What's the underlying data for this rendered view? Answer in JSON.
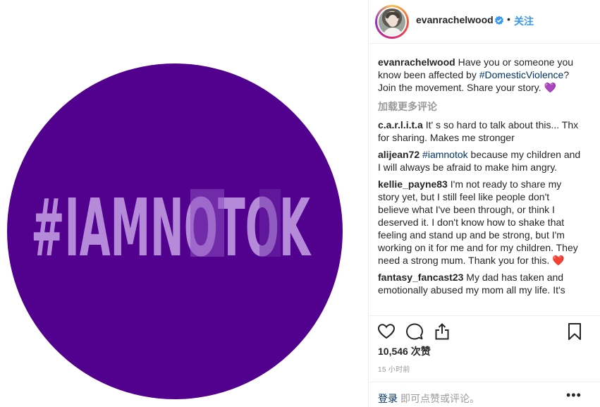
{
  "post": {
    "image": {
      "hashtag_text": "#IAMNOTOK",
      "colors": {
        "circle": "#52008e",
        "text_light": "#b58ad8",
        "text_mid": "#9b63c6",
        "text_dark": "#7a3dae",
        "background": "#ffffff"
      }
    }
  },
  "header": {
    "username": "evanrachelwood",
    "verified_icon": "verified-badge-icon",
    "separator": "•",
    "follow_label": "关注"
  },
  "comments": [
    {
      "user": "evanrachelwood",
      "text_before": "Have you or someone you know been affected by ",
      "hashtag": "#DomesticViolence",
      "text_after": "? Join the movement. Share your story. 💜"
    }
  ],
  "load_more_label": "加载更多评论",
  "replies": [
    {
      "user": "c.a.r.l.i.t.a",
      "text": "It' s so hard to talk about this... Thx for sharing. Makes me stronger"
    },
    {
      "user": "alijean72",
      "hashtag": "#iamnotok",
      "text": " because my children and I will always be afraid to make him angry."
    },
    {
      "user": "kellie_payne83",
      "text": "I'm not ready to share my story yet, but I still feel like people don't believe what I've been through, or think I deserved it. I don't know how to shake that feeling and stand up and be strong, but I'm working on it for me and for my children. They need a strong mum. Thank you for this. ❤️"
    },
    {
      "user": "fantasy_fancast23",
      "text": "My dad has taken and emotionally abused my mom all my life. It's"
    }
  ],
  "actions": {
    "like_icon": "heart-icon",
    "comment_icon": "comment-icon",
    "share_icon": "share-icon",
    "save_icon": "bookmark-icon"
  },
  "likes_label": "10,546 次赞",
  "timestamp": "15 小时前",
  "footer": {
    "login_label": "登录",
    "login_prompt": "即可点赞或评论。",
    "more_label": "•••"
  }
}
